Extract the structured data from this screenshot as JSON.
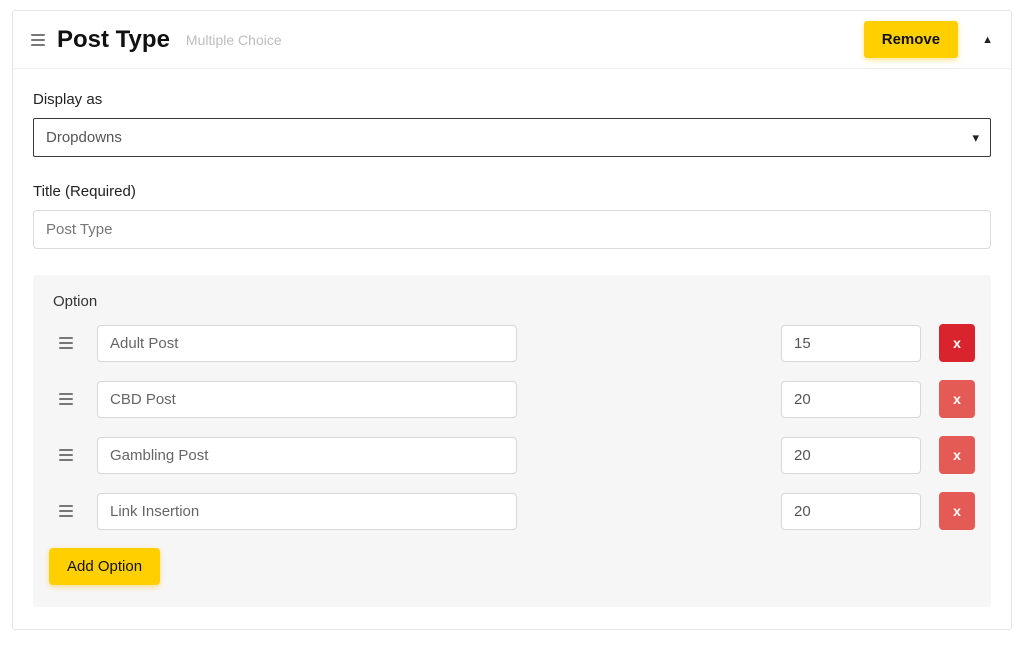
{
  "header": {
    "title": "Post Type",
    "subtitle": "Multiple Choice",
    "remove_label": "Remove"
  },
  "display_as": {
    "label": "Display as",
    "value": "Dropdowns"
  },
  "title_field": {
    "label": "Title (Required)",
    "value": "Post Type"
  },
  "options": {
    "header": "Option",
    "add_label": "Add Option",
    "delete_label": "x",
    "items": [
      {
        "label": "Adult Post",
        "value": "15",
        "delete_style": "strong"
      },
      {
        "label": "CBD Post",
        "value": "20",
        "delete_style": "soft"
      },
      {
        "label": "Gambling Post",
        "value": "20",
        "delete_style": "soft"
      },
      {
        "label": "Link Insertion",
        "value": "20",
        "delete_style": "soft"
      }
    ]
  }
}
